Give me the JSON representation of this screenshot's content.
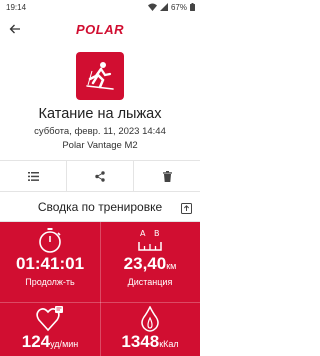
{
  "status_bar": {
    "time": "19:14",
    "battery": "67%"
  },
  "app_bar": {
    "logo": "POLAR"
  },
  "session": {
    "sport_icon": "cross-country-skiing-icon",
    "title": "Катание на лыжах",
    "date": "суббота, февр. 11, 2023 14:44",
    "device": "Polar Vantage M2"
  },
  "actions": [
    {
      "icon": "list-icon"
    },
    {
      "icon": "share-icon"
    },
    {
      "icon": "trash-icon"
    }
  ],
  "summary": {
    "title": "Сводка по тренировке",
    "stats": [
      {
        "icon": "stopwatch-icon",
        "value": "01:41:01",
        "unit": "",
        "label": "Продолж-ть"
      },
      {
        "icon": "distance-icon",
        "value": "23,40",
        "unit": "км",
        "label": "Дистанция"
      },
      {
        "icon": "heart-rate-icon",
        "value": "124",
        "unit": "уд/мин",
        "label": ""
      },
      {
        "icon": "calories-icon",
        "value": "1348",
        "unit": "кКал",
        "label": ""
      }
    ]
  },
  "colors": {
    "brand_red": "#d10e31"
  }
}
